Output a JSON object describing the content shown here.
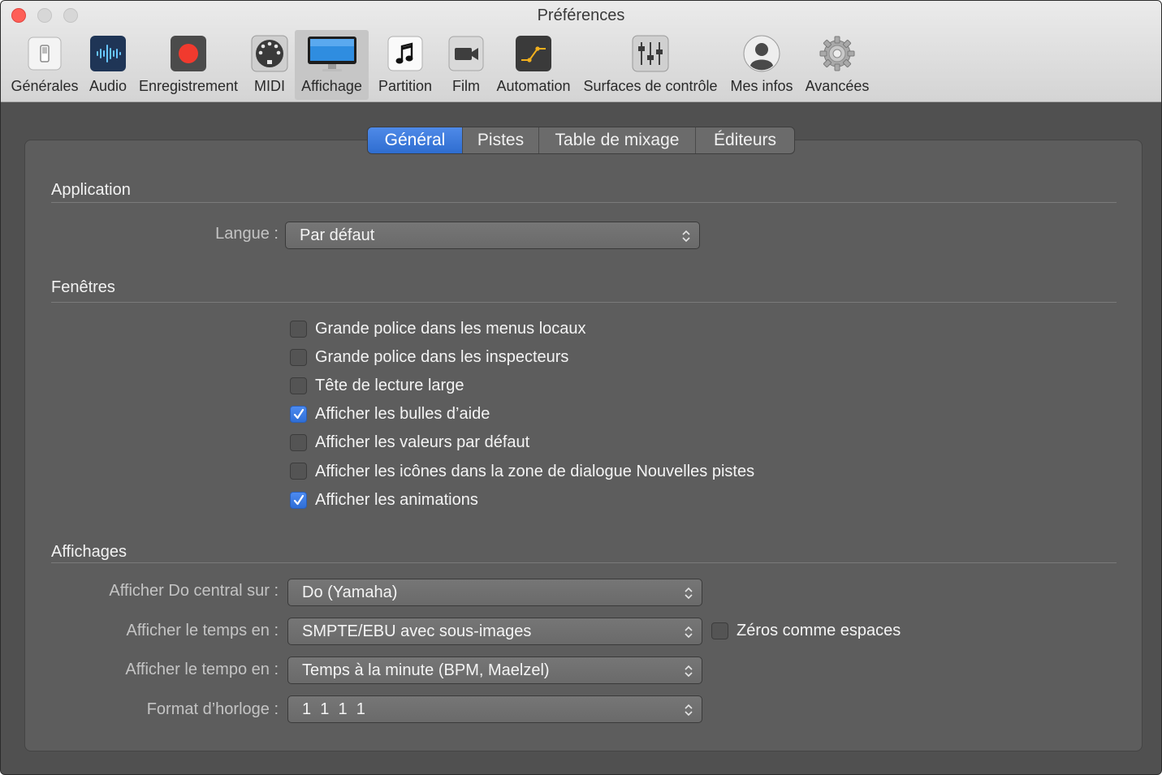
{
  "window": {
    "title": "Préférences"
  },
  "toolbar": {
    "items": [
      {
        "label": "Générales",
        "icon": "general-switch-icon"
      },
      {
        "label": "Audio",
        "icon": "audio-waveform-icon"
      },
      {
        "label": "Enregistrement",
        "icon": "record-icon"
      },
      {
        "label": "MIDI",
        "icon": "midi-port-icon"
      },
      {
        "label": "Affichage",
        "icon": "display-monitor-icon",
        "selected": true
      },
      {
        "label": "Partition",
        "icon": "music-note-icon"
      },
      {
        "label": "Film",
        "icon": "video-camera-icon"
      },
      {
        "label": "Automation",
        "icon": "automation-curve-icon"
      },
      {
        "label": "Surfaces de contrôle",
        "icon": "faders-icon"
      },
      {
        "label": "Mes infos",
        "icon": "user-silhouette-icon"
      },
      {
        "label": "Avancées",
        "icon": "gear-icon"
      }
    ]
  },
  "tabs": [
    {
      "label": "Général",
      "active": true
    },
    {
      "label": "Pistes"
    },
    {
      "label": "Table de mixage"
    },
    {
      "label": "Éditeurs"
    }
  ],
  "application": {
    "title": "Application",
    "language_label": "Langue :",
    "language_value": "Par défaut"
  },
  "fenetres": {
    "title": "Fenêtres",
    "options": [
      {
        "label": "Grande police dans les menus locaux",
        "checked": false
      },
      {
        "label": "Grande police dans les inspecteurs",
        "checked": false
      },
      {
        "label": "Tête de lecture large",
        "checked": false
      },
      {
        "label": "Afficher les bulles d’aide",
        "checked": true
      },
      {
        "label": "Afficher les valeurs par défaut",
        "checked": false
      },
      {
        "label": "Afficher les icônes dans la zone de dialogue Nouvelles pistes",
        "checked": false
      },
      {
        "label": "Afficher les animations",
        "checked": true
      }
    ]
  },
  "affichages": {
    "title": "Affichages",
    "do_central_label": "Afficher Do central sur :",
    "do_central_value": "Do (Yamaha)",
    "temps_label": "Afficher le temps en :",
    "temps_value": "SMPTE/EBU avec sous-images",
    "zeros_label": "Zéros comme espaces",
    "zeros_checked": false,
    "tempo_label": "Afficher le tempo en :",
    "tempo_value": "Temps à la minute (BPM, Maelzel)",
    "horloge_label": "Format d’horloge :",
    "horloge_value": "1  1  1  1"
  },
  "colors": {
    "accent": "#2f6dd0",
    "window_bg": "#505050",
    "panel_bg": "#5d5d5d",
    "toolbar_bg": "#e0e0e0",
    "close_button": "#fe5f57",
    "record_red": "#f13a2e"
  }
}
